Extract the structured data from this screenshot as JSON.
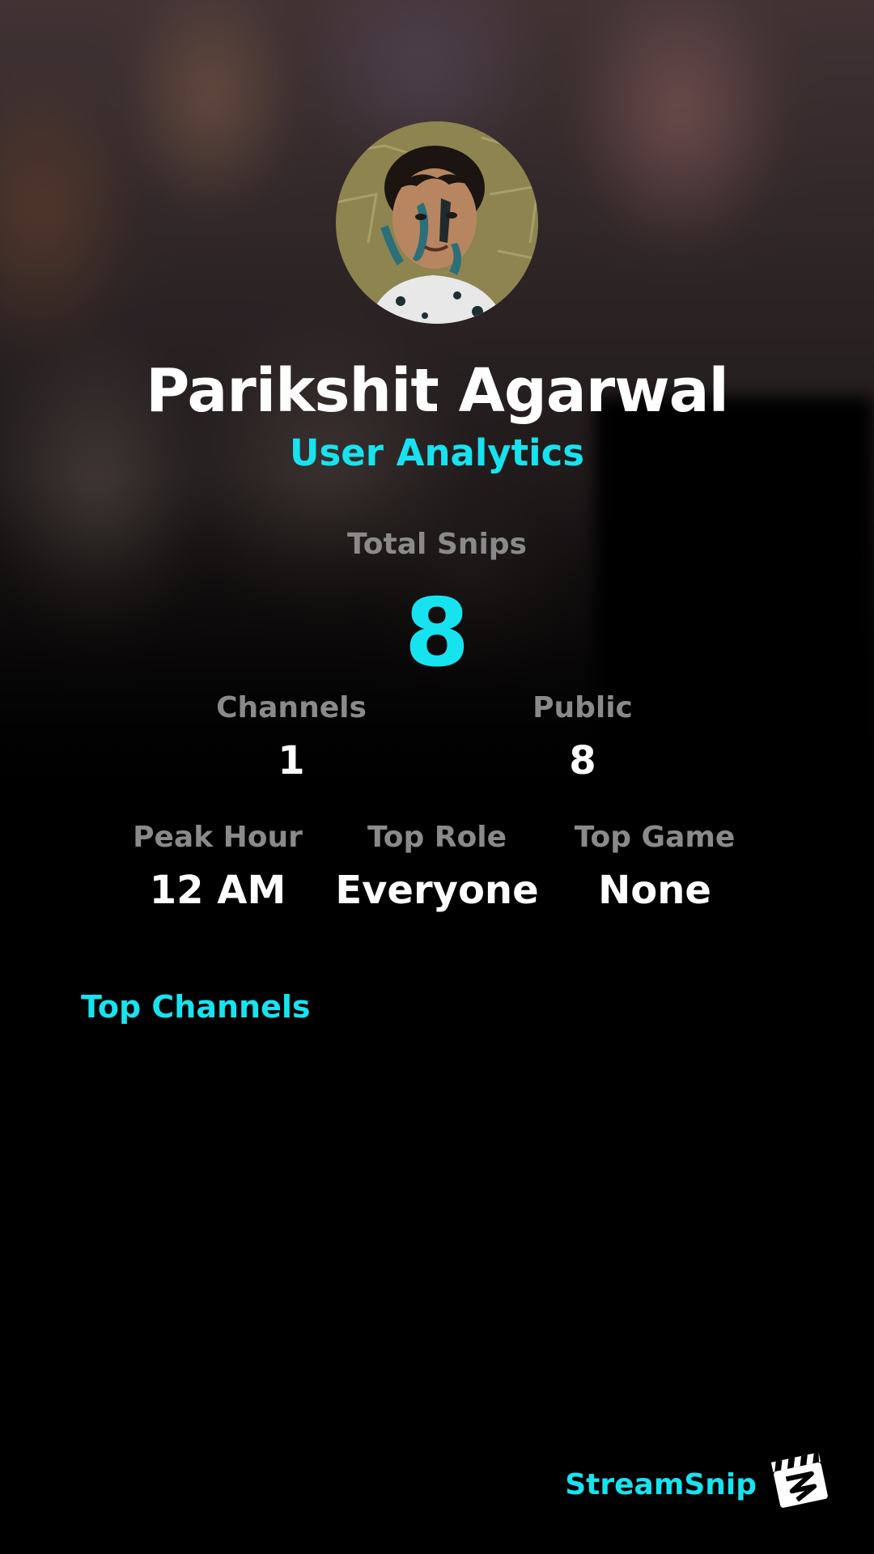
{
  "profile": {
    "name": "Parikshit Agarwal",
    "subtitle": "User Analytics"
  },
  "stats": {
    "total_label": "Total Snips",
    "total_value": "8",
    "channels_label": "Channels",
    "channels_value": "1",
    "public_label": "Public",
    "public_value": "8",
    "peak_hour_label": "Peak Hour",
    "peak_hour_value": "12 AM",
    "top_role_label": "Top Role",
    "top_role_value": "Everyone",
    "top_game_label": "Top Game",
    "top_game_value": "None"
  },
  "sections": {
    "top_channels_title": "Top Channels"
  },
  "brand": {
    "name": "StreamSnip",
    "logo_icon": "clapperboard-icon"
  },
  "colors": {
    "accent": "#17e3f0",
    "label_gray": "#8a8a8a",
    "background": "#000000"
  }
}
